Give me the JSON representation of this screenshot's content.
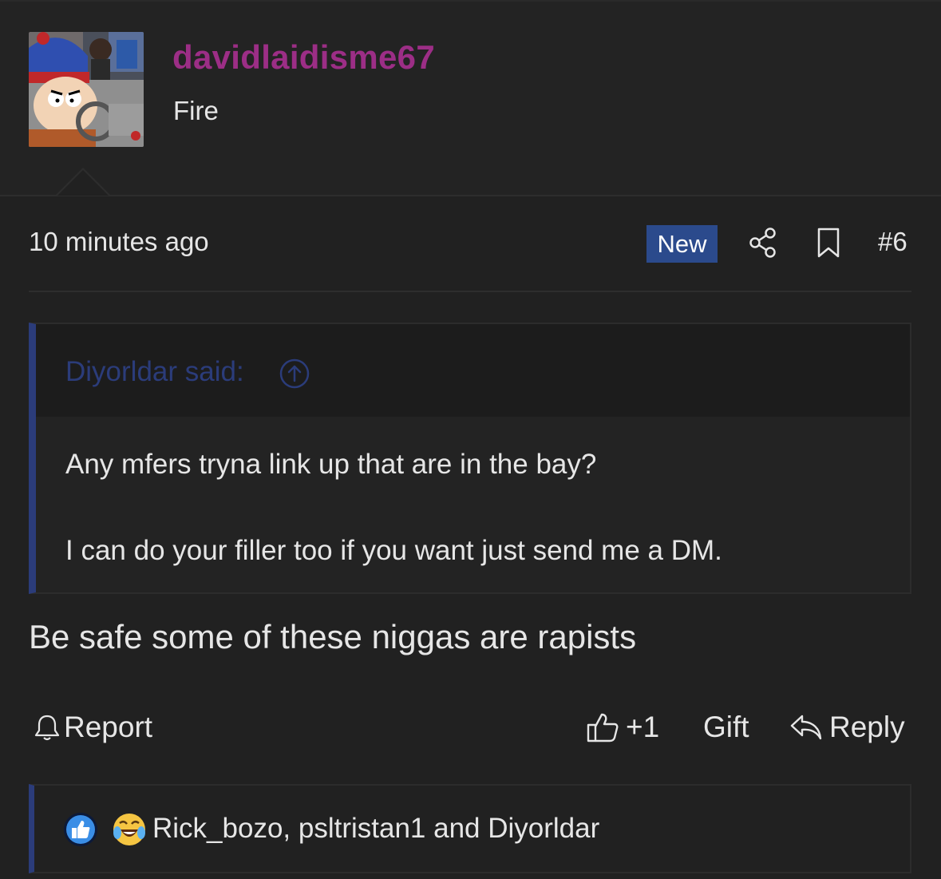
{
  "author": {
    "username": "davidlaidisme67",
    "title": "Fire"
  },
  "post": {
    "timestamp": "10 minutes ago",
    "badge": "New",
    "number": "#6",
    "message": "Be safe some of these niggas are rapists"
  },
  "quote": {
    "author_label": "Diyorldar said:",
    "lines": [
      "Any mfers tryna link up that are in the bay?",
      "I can do your filler too if you want just send me a DM."
    ]
  },
  "actions": {
    "report": "Report",
    "like_count": "+1",
    "gift": "Gift",
    "reply": "Reply"
  },
  "reactions": {
    "icons": [
      "like-reaction-icon",
      "laugh-crying-reaction-icon"
    ],
    "names": "Rick_bozo, psltristan1 and Diyorldar"
  },
  "colors": {
    "background": "#212121",
    "username": "#9c2e86",
    "accent_blue": "#2b4a8c",
    "quote_blue": "#2b3c7a"
  }
}
